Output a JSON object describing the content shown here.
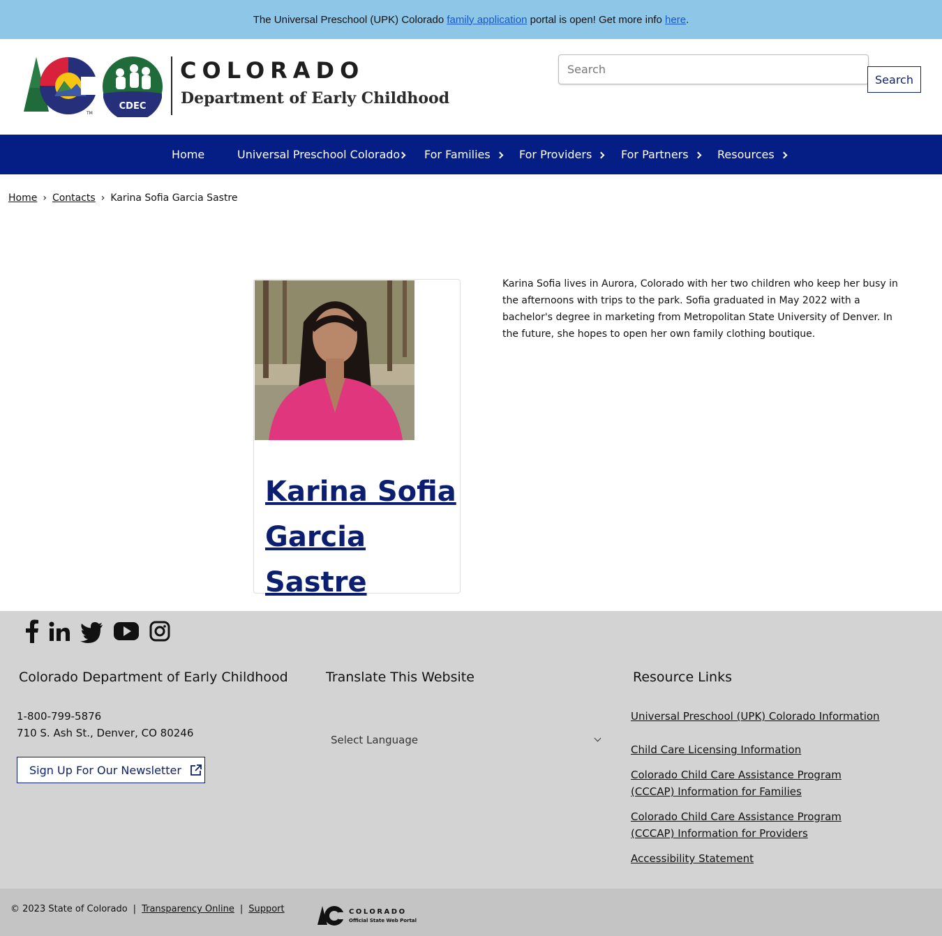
{
  "alert": {
    "prefix": "The Universal Preschool (UPK) Colorado ",
    "link1": "family application",
    "middle": " portal is open! Get more info ",
    "link2": "here",
    "suffix": "."
  },
  "header": {
    "logo_cdec_text": "CDEC",
    "title": "COLORADO",
    "subtitle": "Department of Early Childhood",
    "search_placeholder": "Search",
    "search_button": "Search"
  },
  "nav": {
    "items": [
      {
        "label": "Home"
      },
      {
        "label": "Universal Preschool Colorado"
      },
      {
        "label": "For Families"
      },
      {
        "label": "For Providers"
      },
      {
        "label": "For Partners"
      },
      {
        "label": "Resources"
      }
    ]
  },
  "breadcrumb": {
    "items": [
      "Home",
      "Contacts",
      "Karina Sofia Garcia Sastre"
    ],
    "separator": "›"
  },
  "profile": {
    "name": "Karina Sofia Garcia Sastre",
    "bio": "Karina Sofia lives in Aurora, Colorado with her two children who keep her busy in the afternoons with trips to the park. Sofia graduated in May 2022 with a bachelor's degree in marketing from Metropolitan State University of Denver. In the future, she hopes to open her own family clothing boutique."
  },
  "footer": {
    "social": [
      "facebook-icon",
      "linkedin-icon",
      "twitter-icon",
      "youtube-icon",
      "instagram-icon"
    ],
    "contact_heading": "Colorado Department of Early Childhood",
    "phone": "1-800-799-5876",
    "address": "710 S. Ash St., Denver, CO 80246",
    "newsletter_button": "Sign Up For Our Newsletter",
    "translate_heading": "Translate This Website",
    "language_select": "Select Language",
    "resources_heading": "Resource Links",
    "resource_links": [
      "Universal Preschool (UPK) Colorado Information",
      "Child Care Licensing Information",
      "Colorado Child Care Assistance Program (CCCAP) Information for Families",
      "Colorado Child Care Assistance Program (CCCAP) Information for Providers",
      "Accessibility Statement"
    ]
  },
  "bottom": {
    "copyright": "© 2023 State of Colorado",
    "transparency": "Transparency Online",
    "support": "Support",
    "portal_title": "COLORADO",
    "portal_sub": "Official State Web Portal"
  },
  "colors": {
    "alert_bg": "#8ec6e7",
    "nav_bg": "#041e85",
    "footer_bg": "#d3d3d3",
    "bottom_bg": "#c4c4c4",
    "link_blue": "#0b1e70"
  }
}
